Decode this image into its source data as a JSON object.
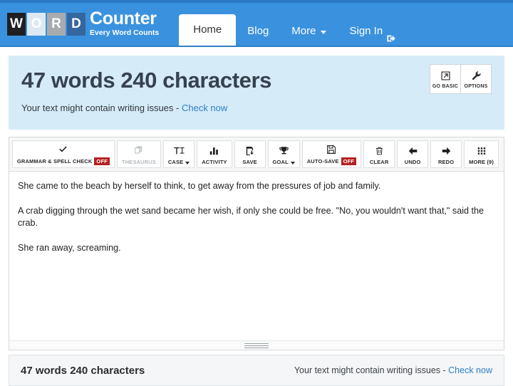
{
  "nav": {
    "logo_tiles": [
      "W",
      "O",
      "R",
      "D"
    ],
    "brand_name": "Counter",
    "brand_tagline": "Every Word Counts",
    "items": [
      {
        "label": "Home",
        "active": true
      },
      {
        "label": "Blog",
        "active": false
      },
      {
        "label": "More",
        "active": false,
        "icon": "chevron-down-icon"
      },
      {
        "label": "Sign In",
        "active": false,
        "icon": "sign-in-icon"
      }
    ],
    "colors": {
      "bar": "#3a92de",
      "top_strip": "#2a79c4",
      "tile_w_bg": "#1f1f24",
      "tile_o_bg": "#dce9f3",
      "tile_r_bg": "#a8abae",
      "tile_d_bg": "#35669e"
    }
  },
  "banner": {
    "counts": "47 words 240 characters",
    "notice_text": "Your text might contain writing issues - ",
    "notice_link": "Check now",
    "background": "#d5ebf7",
    "actions": [
      {
        "label": "GO BASIC",
        "icon": "external-link-icon"
      },
      {
        "label": "OPTIONS",
        "icon": "wrench-icon"
      }
    ]
  },
  "toolbar": {
    "buttons": [
      {
        "label": "GRAMMAR & SPELL CHECK",
        "icon": "check-icon",
        "badge": "OFF",
        "disabled": false,
        "caret": false
      },
      {
        "label": "THESAURUS",
        "icon": "book-icon",
        "badge": null,
        "disabled": true,
        "caret": false
      },
      {
        "label": "CASE",
        "icon": "text-case-icon",
        "badge": null,
        "disabled": false,
        "caret": true
      },
      {
        "label": "ACTIVITY",
        "icon": "bar-chart-icon",
        "badge": null,
        "disabled": false,
        "caret": false
      },
      {
        "label": "SAVE",
        "icon": "save-download-icon",
        "badge": null,
        "disabled": false,
        "caret": false
      },
      {
        "label": "GOAL",
        "icon": "trophy-icon",
        "badge": null,
        "disabled": false,
        "caret": true
      },
      {
        "label": "AUTO-SAVE",
        "icon": "floppy-disk-icon",
        "badge": "OFF",
        "disabled": false,
        "caret": false
      },
      {
        "label": "CLEAR",
        "icon": "trash-icon",
        "badge": null,
        "disabled": false,
        "caret": false
      },
      {
        "label": "UNDO",
        "icon": "arrow-left-icon",
        "badge": null,
        "disabled": false,
        "caret": false
      },
      {
        "label": "REDO",
        "icon": "arrow-right-icon",
        "badge": null,
        "disabled": false,
        "caret": false
      },
      {
        "label": "MORE (9)",
        "icon": "grid-icon",
        "badge": null,
        "disabled": false,
        "caret": false
      }
    ],
    "badge_color": "#b62020"
  },
  "editor": {
    "paragraphs": [
      "She came to the beach by herself to think, to get away from the pressures of job and family.",
      "A crab digging through the wet sand became her wish, if only she could be free. \"No, you wouldn't want that,\" said the crab.",
      "She ran away, screaming."
    ]
  },
  "statusbar": {
    "counts": "47 words 240 characters",
    "notice_text": "Your text might contain writing issues - ",
    "notice_link": "Check now"
  }
}
